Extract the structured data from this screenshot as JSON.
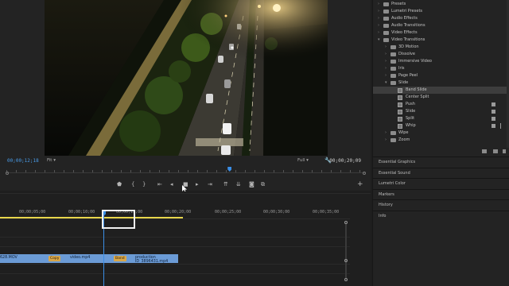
{
  "program_monitor": {
    "current_timecode": "00;00;12;18",
    "zoom": "Fit",
    "resolution": "Full",
    "duration_timecode": "00;00;20;09",
    "playhead_fraction": 0.62
  },
  "transport": {
    "icons": [
      "marker-icon",
      "in-point-icon",
      "out-point-icon",
      "go-to-in-icon",
      "step-back-icon",
      "stop-icon",
      "step-forward-icon",
      "go-to-out-icon",
      "lift-icon",
      "extract-icon",
      "export-frame-icon",
      "comparison-view-icon",
      "add-button-icon"
    ]
  },
  "timeline": {
    "ruler_labels": [
      "00;00;05;00",
      "00;00;10;00",
      "00;00;15;00",
      "00;00;20;00",
      "00;00;25;00",
      "00;00;30;00",
      "00;00;35;00"
    ],
    "clips": [
      {
        "label": "628.MOV"
      },
      {
        "badge": "Copy"
      },
      {
        "label": "video.mp4"
      },
      {
        "badge": "Band"
      },
      {
        "label": "production ID_3896431.mp4"
      }
    ]
  },
  "effects_panel": {
    "items": [
      {
        "label": "Presets",
        "type": "folder",
        "level": 0
      },
      {
        "label": "Lumetri Presets",
        "type": "folder",
        "level": 0
      },
      {
        "label": "Audio Effects",
        "type": "folder",
        "level": 0
      },
      {
        "label": "Audio Transitions",
        "type": "folder",
        "level": 0
      },
      {
        "label": "Video Effects",
        "type": "folder",
        "level": 0
      },
      {
        "label": "Video Transitions",
        "type": "folder",
        "level": 0,
        "open": true
      },
      {
        "label": "3D Motion",
        "type": "folder",
        "level": 1
      },
      {
        "label": "Dissolve",
        "type": "folder",
        "level": 1
      },
      {
        "label": "Immersive Video",
        "type": "folder",
        "level": 1
      },
      {
        "label": "Iris",
        "type": "folder",
        "level": 1
      },
      {
        "label": "Page Peel",
        "type": "folder",
        "level": 1
      },
      {
        "label": "Slide",
        "type": "folder",
        "level": 1,
        "open": true
      },
      {
        "label": "Band Slide",
        "type": "effect",
        "level": 2,
        "selected": true
      },
      {
        "label": "Center Split",
        "type": "effect",
        "level": 2
      },
      {
        "label": "Push",
        "type": "effect",
        "level": 2,
        "badge": true
      },
      {
        "label": "Slide",
        "type": "effect",
        "level": 2,
        "badge": true
      },
      {
        "label": "Split",
        "type": "effect",
        "level": 2,
        "badge": true
      },
      {
        "label": "Whip",
        "type": "effect",
        "level": 2,
        "badge": true,
        "bar": true
      },
      {
        "label": "Wipe",
        "type": "folder",
        "level": 1
      },
      {
        "label": "Zoom",
        "type": "folder",
        "level": 1
      }
    ],
    "sections": [
      "Essential Graphics",
      "Essential Sound",
      "Lumetri Color",
      "Markers",
      "History",
      "Info"
    ]
  }
}
